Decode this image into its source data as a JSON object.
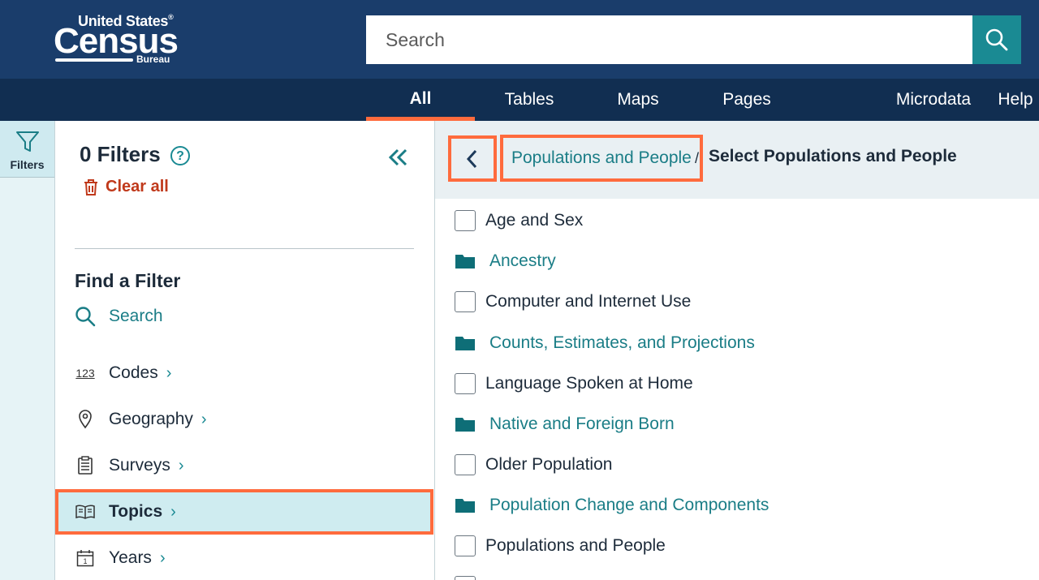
{
  "header": {
    "logo": {
      "united_states": "United States",
      "census": "Census",
      "bureau": "Bureau"
    },
    "search_placeholder": "Search",
    "search_button_icon": "magnifier-icon"
  },
  "nav": {
    "tabs": [
      {
        "label": "All",
        "active": true
      },
      {
        "label": "Tables"
      },
      {
        "label": "Maps"
      },
      {
        "label": "Pages"
      },
      {
        "label": "Microdata"
      },
      {
        "label": "Help"
      }
    ]
  },
  "rail": {
    "filters_label": "Filters"
  },
  "panel": {
    "title": "0 Filters",
    "help_icon": "?",
    "clear_all": "Clear all",
    "find_title": "Find a Filter",
    "search_label": "Search",
    "codes_icon_text": "123",
    "items": [
      {
        "label": "Codes",
        "icon": "codes-icon"
      },
      {
        "label": "Geography",
        "icon": "map-pin-icon"
      },
      {
        "label": "Surveys",
        "icon": "clipboard-icon"
      },
      {
        "label": "Topics",
        "icon": "book-icon",
        "selected": true
      },
      {
        "label": "Years",
        "icon": "calendar-icon"
      }
    ]
  },
  "main": {
    "breadcrumb": {
      "link": "Populations and People",
      "separator": "/",
      "current": "Select Populations and People"
    },
    "options": [
      {
        "label": "Age and Sex",
        "kind": "checkbox"
      },
      {
        "label": "Ancestry",
        "kind": "folder"
      },
      {
        "label": "Computer and Internet Use",
        "kind": "checkbox"
      },
      {
        "label": "Counts, Estimates, and Projections",
        "kind": "folder"
      },
      {
        "label": "Language Spoken at Home",
        "kind": "checkbox"
      },
      {
        "label": "Native and Foreign Born",
        "kind": "folder"
      },
      {
        "label": "Older Population",
        "kind": "checkbox"
      },
      {
        "label": "Population Change and Components",
        "kind": "folder"
      },
      {
        "label": "Populations and People",
        "kind": "checkbox"
      }
    ]
  },
  "colors": {
    "header_bg": "#1a3d6b",
    "nav_bg": "#112e51",
    "accent_teal": "#1a8a93",
    "highlight_orange": "#ff6b3d",
    "clear_all_red": "#c0391b"
  }
}
